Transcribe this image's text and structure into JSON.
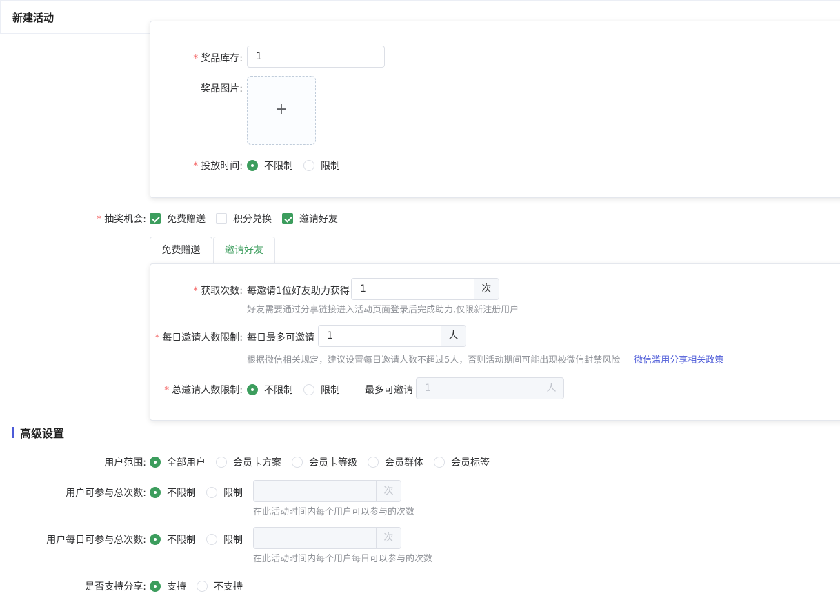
{
  "header": {
    "title": "新建活动"
  },
  "prize": {
    "stock_label": "奖品库存:",
    "stock_value": "1",
    "image_label": "奖品图片:",
    "upload_plus": "+",
    "time_label": "投放时间:",
    "time_unlimited": "不限制",
    "time_limited": "限制"
  },
  "lottery": {
    "label": "抽奖机会:",
    "options": [
      "免费赠送",
      "积分兑换",
      "邀请好友"
    ],
    "checked": [
      true,
      false,
      true
    ]
  },
  "tabs": [
    "免费赠送",
    "邀请好友"
  ],
  "invite": {
    "get_count_label": "获取次数:",
    "get_count_prefix": "每邀请1位好友助力获得",
    "get_count_value": "1",
    "get_count_unit": "次",
    "get_count_hint": "好友需要通过分享链接进入活动页面登录后完成助力,仅限新注册用户",
    "daily_label": "每日邀请人数限制:",
    "daily_prefix": "每日最多可邀请",
    "daily_value": "1",
    "daily_unit": "人",
    "daily_hint": "根据微信相关规定，建议设置每日邀请人数不超过5人，否则活动期间可能出现被微信封禁风险",
    "daily_link": "微信滥用分享相关政策",
    "total_label": "总邀请人数限制:",
    "total_unlimited": "不限制",
    "total_limited": "限制",
    "total_max_label": "最多可邀请",
    "total_value": "1",
    "total_unit": "人"
  },
  "advanced": {
    "title": "高级设置",
    "scope_label": "用户范围:",
    "scope_options": [
      "全部用户",
      "会员卡方案",
      "会员卡等级",
      "会员群体",
      "会员标签"
    ],
    "total_join_label": "用户可参与总次数:",
    "total_join_unlimited": "不限制",
    "total_join_limited": "限制",
    "total_join_unit": "次",
    "total_join_hint": "在此活动时间内每个用户可以参与的次数",
    "daily_join_label": "用户每日可参与总次数:",
    "daily_join_unlimited": "不限制",
    "daily_join_limited": "限制",
    "daily_join_unit": "次",
    "daily_join_hint": "在此活动时间内每个用户每日可以参与的次数",
    "share_label": "是否支持分享:",
    "share_yes": "支持",
    "share_no": "不支持"
  },
  "colors": {
    "accent": "#3c9d5d",
    "required": "#f56c6c",
    "link": "#4d5bd8",
    "section_bar": "#4d5bd8"
  }
}
